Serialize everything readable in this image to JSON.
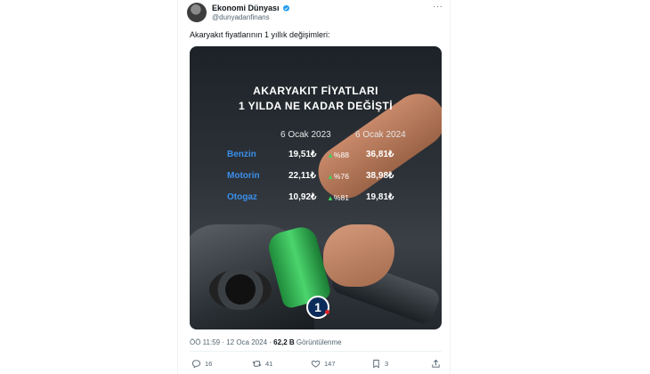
{
  "tweet": {
    "display_name": "Ekonomi Dünyası",
    "handle": "@dunyadanfinans",
    "text": "Akaryakıt fiyatlarının 1 yıllık değişimleri:",
    "more_label": "···",
    "timestamp": "ÖÖ 11:59 · 12 Oca 2024 · ",
    "views_count": "62,2 B",
    "views_label": " Görüntülenme"
  },
  "image": {
    "headline_line1": "AKARYAKIT FİYATLARI",
    "headline_line2": "1 YILDA NE KADAR DEĞİŞTİ",
    "col_old": "6 Ocak 2023",
    "col_new": "6 Ocak 2024",
    "rows": [
      {
        "label": "Benzin",
        "old": "19,51₺",
        "change": "%88",
        "new": "36,81₺"
      },
      {
        "label": "Motorin",
        "old": "22,11₺",
        "change": "%76",
        "new": "38,98₺"
      },
      {
        "label": "Otogaz",
        "old": "10,92₺",
        "change": "%81",
        "new": "19,81₺"
      }
    ],
    "logo_text": "1",
    "colors": {
      "label_blue": "#3b8eea",
      "change_green": "#3fd25b",
      "logo_navy": "#0b2c5a"
    }
  },
  "actions": {
    "reply_count": "16",
    "retweet_count": "41",
    "like_count": "147",
    "bookmark_count": "3"
  },
  "icons": [
    "verified-badge-icon",
    "more-icon",
    "reply-icon",
    "retweet-icon",
    "like-icon",
    "bookmark-icon",
    "share-icon"
  ]
}
